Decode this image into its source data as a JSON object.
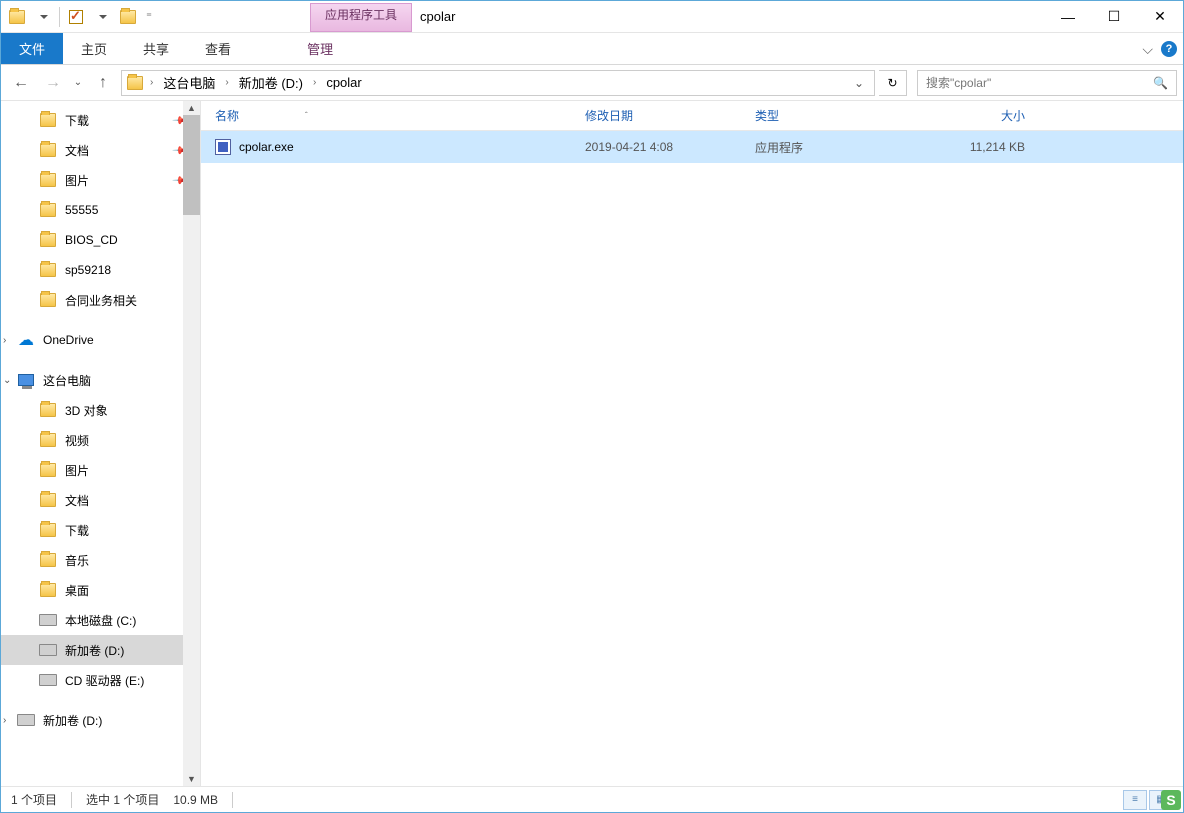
{
  "titlebar": {
    "context_tab": "应用程序工具",
    "title": "cpolar"
  },
  "win": {
    "min": "—",
    "max": "☐",
    "close": "✕"
  },
  "tabs": {
    "file": "文件",
    "home": "主页",
    "share": "共享",
    "view": "查看",
    "manage": "管理"
  },
  "nav": {
    "breadcrumb": [
      "这台电脑",
      "新加卷 (D:)",
      "cpolar"
    ],
    "refresh": "↻",
    "search_placeholder": "搜索\"cpolar\""
  },
  "sidebar": {
    "quick": [
      {
        "label": "下载",
        "pin": true
      },
      {
        "label": "文档",
        "pin": true
      },
      {
        "label": "图片",
        "pin": true
      },
      {
        "label": "55555",
        "pin": false
      },
      {
        "label": "BIOS_CD",
        "pin": false
      },
      {
        "label": "sp59218",
        "pin": false
      },
      {
        "label": "合同业务相关",
        "pin": false
      }
    ],
    "onedrive": "OneDrive",
    "thispc_label": "这台电脑",
    "thispc": [
      {
        "label": "3D 对象",
        "ico": "3d"
      },
      {
        "label": "视频",
        "ico": "vid"
      },
      {
        "label": "图片",
        "ico": "pic"
      },
      {
        "label": "文档",
        "ico": "doc"
      },
      {
        "label": "下载",
        "ico": "dl"
      },
      {
        "label": "音乐",
        "ico": "mus"
      },
      {
        "label": "桌面",
        "ico": "desk"
      },
      {
        "label": "本地磁盘 (C:)",
        "ico": "drive"
      },
      {
        "label": "新加卷 (D:)",
        "ico": "drive",
        "sel": true
      },
      {
        "label": "CD 驱动器 (E:)",
        "ico": "cd"
      }
    ],
    "extra": [
      {
        "label": "新加卷 (D:)",
        "ico": "drive"
      }
    ]
  },
  "columns": {
    "name": "名称",
    "date": "修改日期",
    "type": "类型",
    "size": "大小"
  },
  "files": [
    {
      "name": "cpolar.exe",
      "date": "2019-04-21 4:08",
      "type": "应用程序",
      "size": "11,214 KB",
      "sel": true
    }
  ],
  "status": {
    "count": "1 个项目",
    "selected": "选中 1 个项目",
    "size": "10.9 MB"
  }
}
